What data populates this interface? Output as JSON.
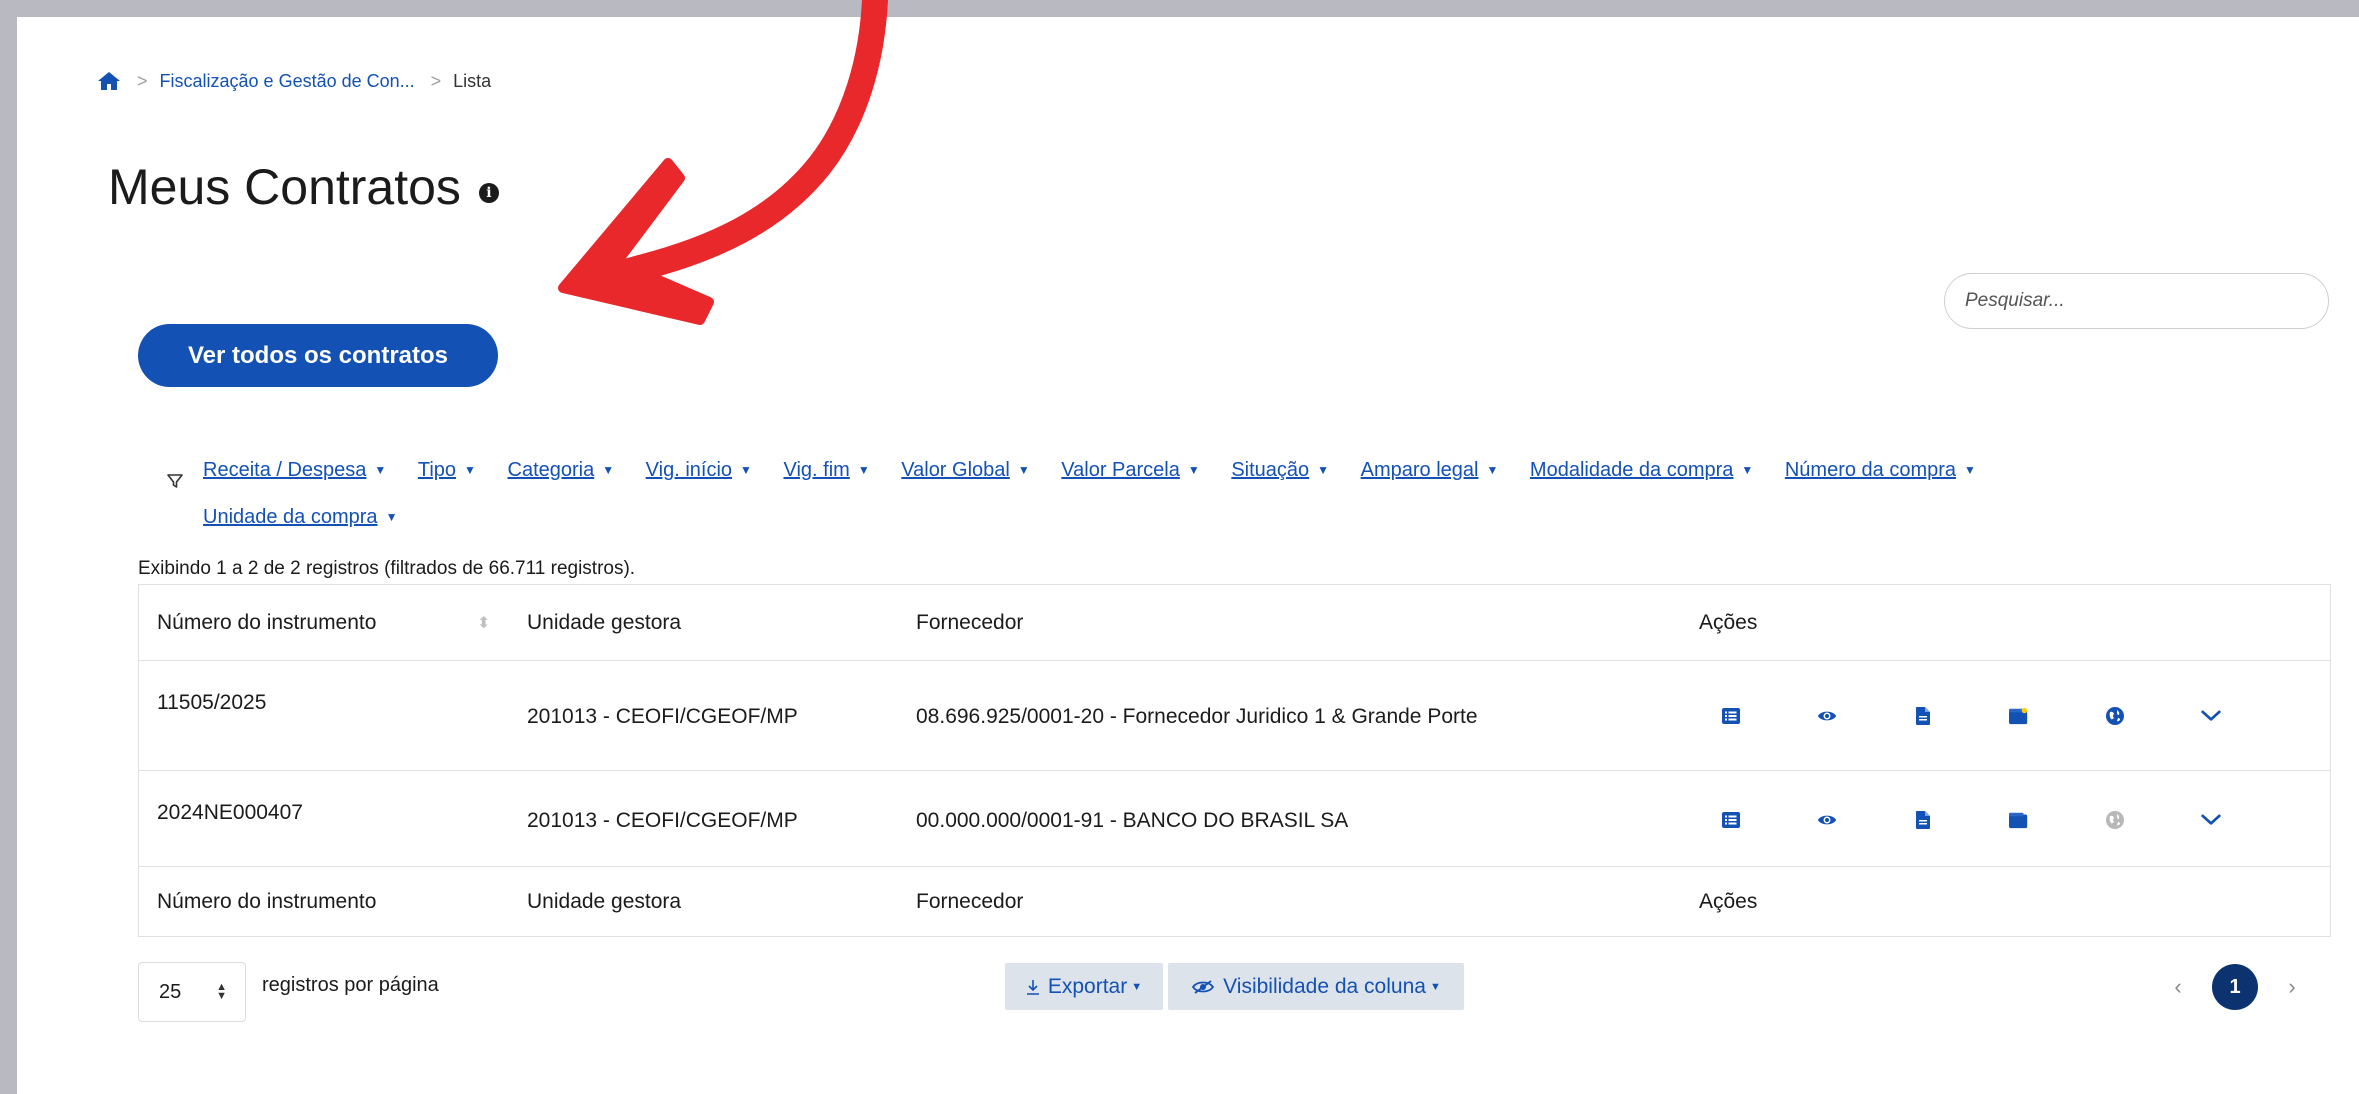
{
  "breadcrumb": {
    "home_icon": "home-icon",
    "items": [
      "Fiscalização e Gestão de Con...",
      "Lista"
    ]
  },
  "page": {
    "title": "Meus Contratos",
    "info_icon": "info-icon"
  },
  "search": {
    "placeholder": "Pesquisar..."
  },
  "primary_button": {
    "label": "Ver todos os contratos"
  },
  "filters": [
    "Receita / Despesa",
    "Tipo",
    "Categoria",
    "Vig. início",
    "Vig. fim",
    "Valor Global",
    "Valor Parcela",
    "Situação",
    "Amparo legal",
    "Modalidade da compra",
    "Número da compra",
    "Unidade da compra"
  ],
  "records_info": "Exibindo 1 a 2 de 2 registros (filtrados de 66.711 registros).",
  "table": {
    "columns": [
      "Número do instrumento",
      "Unidade gestora",
      "Fornecedor",
      "Ações"
    ],
    "rows": [
      {
        "numero": "11505/2025",
        "unidade": "201013 - CEOFI/CGEOF/MP",
        "fornecedor": "08.696.925/0001-20 - Fornecedor Juridico 1 & Grande Porte"
      },
      {
        "numero": "2024NE000407",
        "unidade": "201013 - CEOFI/CGEOF/MP",
        "fornecedor": "00.000.000/0001-91 - BANCO DO BRASIL SA"
      }
    ],
    "action_icons": [
      "list-icon",
      "eye-icon",
      "document-icon",
      "wallet-icon",
      "globe-icon",
      "chevron-down-icon"
    ]
  },
  "pagination": {
    "per_page": "25",
    "per_page_label": "registros por página",
    "export_label": "Exportar",
    "visibility_label": "Visibilidade da coluna",
    "current_page": "1"
  },
  "colors": {
    "primary": "#1351b4",
    "page_active": "#0c326f",
    "annotation_arrow": "#e8282b"
  }
}
